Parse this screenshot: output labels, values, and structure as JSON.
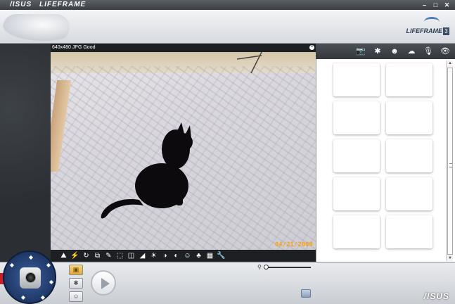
{
  "titlebar": {
    "brand": "/ISUS",
    "app_name": "LIFEFRAME",
    "minimize": "–",
    "maximize": "□",
    "close": "✕"
  },
  "banner": {
    "product_name": "LIFEFRAME",
    "version": "3"
  },
  "video": {
    "info": "640x480 JPG Good",
    "timestamp": "04/21/2009"
  },
  "video_toolbar": {
    "tools": [
      "person-icon",
      "flash-icon",
      "timer-icon",
      "frames-icon",
      "pen-icon",
      "crop-icon",
      "rotate-icon",
      "exposure-icon",
      "brightness-icon",
      "contrast-icon",
      "tint-icon",
      "face-icon",
      "color-icon",
      "levels-icon",
      "wrench-icon"
    ],
    "glyphs": [
      "⛰",
      "⚡",
      "↻",
      "⧉",
      "✎",
      "⬚",
      "◫",
      "◢",
      "☀",
      "◑",
      "◐",
      "☺",
      "♣",
      "▦",
      "🔧"
    ]
  },
  "right_panel": {
    "tabs": [
      {
        "name": "camera-tab-icon",
        "glyph": "📷"
      },
      {
        "name": "settings-tab-icon",
        "glyph": "✱"
      },
      {
        "name": "face-tab-icon",
        "glyph": "☻"
      },
      {
        "name": "scene-tab-icon",
        "glyph": "☁"
      },
      {
        "name": "mic-tab-icon",
        "glyph": "🎙"
      },
      {
        "name": "eye-tab-icon",
        "glyph": "👁"
      }
    ],
    "thumbnail_count": 10
  },
  "bottom": {
    "zoom_icon": "⚲",
    "mode_buttons": [
      {
        "name": "camera-mode-button",
        "glyph": "▣",
        "active": true
      },
      {
        "name": "settings-mode-button",
        "glyph": "✱",
        "active": false
      },
      {
        "name": "effects-mode-button",
        "glyph": "☺",
        "active": false
      }
    ],
    "brand": "/ISUS"
  }
}
